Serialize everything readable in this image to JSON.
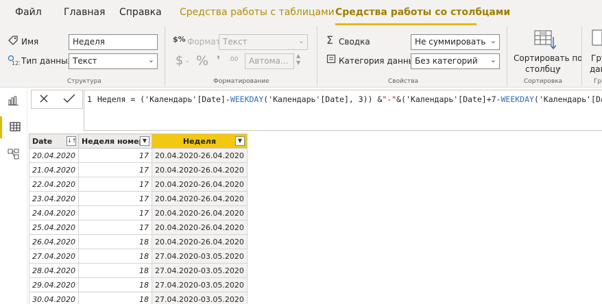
{
  "menu": {
    "tabs": [
      {
        "label": "Файл"
      },
      {
        "label": "Главная"
      },
      {
        "label": "Справка"
      },
      {
        "label": "Средства работы с таблицами"
      },
      {
        "label": "Средства работы со столбцами"
      }
    ],
    "active_tab": "Средства работы со столбцами"
  },
  "ribbon": {
    "structure": {
      "group_label": "Структура",
      "name_label": "Имя",
      "name_value": "Неделя",
      "type_label": "Тип данных",
      "type_value": "Текст"
    },
    "formatting": {
      "group_label": "Форматирование",
      "format_label": "Формат",
      "format_value": "Текст",
      "currency_symbol": "$",
      "percent_symbol": "%",
      "comma_symbol": "❜",
      "auto_value": "Автома..."
    },
    "properties": {
      "group_label": "Свойства",
      "summary_label": "Сводка",
      "summary_value": "Не суммировать",
      "category_label": "Категория данных",
      "category_value": "Без категорий"
    },
    "sort": {
      "group_label": "Сортировка",
      "button_line1": "Сортировать по",
      "button_line2": "столбцу"
    },
    "groups_partial": {
      "line1": "Гру",
      "line2": "дан",
      "group_label": "Гр"
    }
  },
  "formula": {
    "line_number": "1",
    "segments": [
      {
        "text": "Неделя = ('Календарь'[Date]-",
        "kind": "plain"
      },
      {
        "text": "WEEKDAY",
        "kind": "fn"
      },
      {
        "text": "('Календарь'[Date], 3)) &",
        "kind": "plain"
      },
      {
        "text": "\"-\"",
        "kind": "str"
      },
      {
        "text": "&('Календарь'[Date]+7-",
        "kind": "plain"
      },
      {
        "text": "WEEKDAY",
        "kind": "fn"
      },
      {
        "text": "('Календарь'[Date],",
        "kind": "plain"
      }
    ]
  },
  "table": {
    "columns": [
      "Date",
      "Неделя номер",
      "Неделя"
    ],
    "rows": [
      [
        "20.04.2020",
        "17",
        "20.04.2020-26.04.2020"
      ],
      [
        "21.04.2020",
        "17",
        "20.04.2020-26.04.2020"
      ],
      [
        "22.04.2020",
        "17",
        "20.04.2020-26.04.2020"
      ],
      [
        "23.04.2020",
        "17",
        "20.04.2020-26.04.2020"
      ],
      [
        "24.04.2020",
        "17",
        "20.04.2020-26.04.2020"
      ],
      [
        "25.04.2020",
        "17",
        "20.04.2020-26.04.2020"
      ],
      [
        "26.04.2020",
        "18",
        "20.04.2020-26.04.2020"
      ],
      [
        "27.04.2020",
        "18",
        "27.04.2020-03.05.2020"
      ],
      [
        "28.04.2020",
        "18",
        "27.04.2020-03.05.2020"
      ],
      [
        "29.04.2020",
        "18",
        "27.04.2020-03.05.2020"
      ],
      [
        "30.04.2020",
        "18",
        "27.04.2020-03.05.2020"
      ]
    ]
  },
  "colors": {
    "accent": "#f2c811",
    "context_tab": "#b08d00",
    "function": "#2f6fba",
    "string": "#a31515"
  }
}
